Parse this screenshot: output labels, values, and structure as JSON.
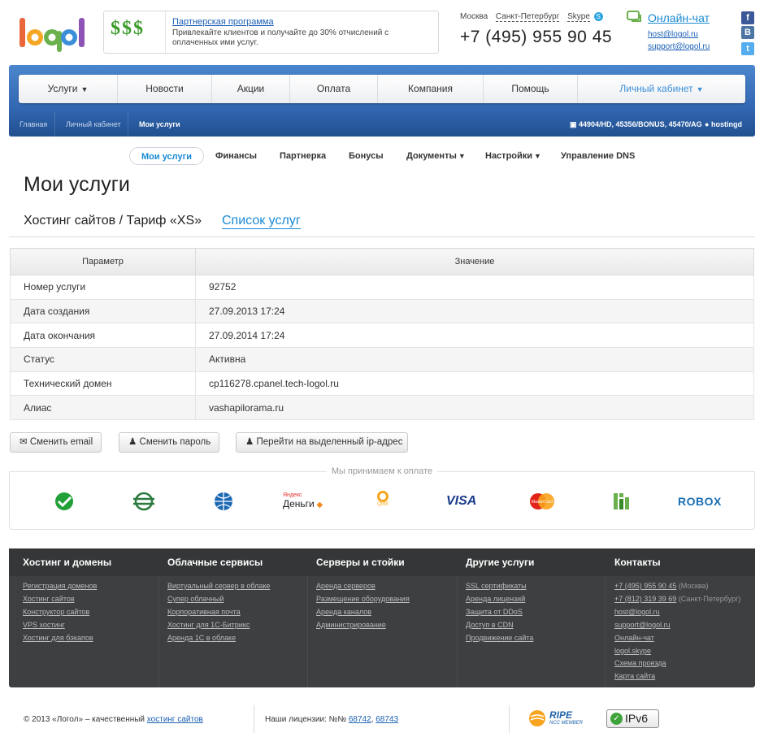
{
  "header": {
    "promo_title": "Партнерская программа",
    "promo_text": "Привлекайте клиентов и получайте до 30% отчислений с оплаченных ими услуг.",
    "cities": [
      "Москва",
      "Санкт-Петербург",
      "Skype"
    ],
    "phone": "+7 (495) 955 90 45",
    "chat": "Онлайн-чат",
    "email1": "host@logol.ru",
    "email2": "support@logol.ru",
    "social": [
      "f",
      "B",
      "t"
    ]
  },
  "menu": [
    "Услуги",
    "Новости",
    "Акции",
    "Оплата",
    "Компания",
    "Помощь",
    "Личный кабинет"
  ],
  "breadcrumbs": [
    "Главная",
    "Личный кабинет",
    "Мои услуги"
  ],
  "account_ids": "44904/HD, 45356/BONUS, 45470/AG",
  "username": "hostingd",
  "subnav": [
    "Мои услуги",
    "Финансы",
    "Партнерка",
    "Бонусы",
    "Документы",
    "Настройки",
    "Управление DNS"
  ],
  "page_title": "Мои услуги",
  "service_title": "Хостинг сайтов / Тариф «XS»",
  "service_list_link": "Список услуг",
  "table": {
    "headers": [
      "Параметр",
      "Значение"
    ],
    "rows": [
      [
        "Номер услуги",
        "92752"
      ],
      [
        "Дата создания",
        "27.09.2013 17:24"
      ],
      [
        "Дата окончания",
        "27.09.2014 17:24"
      ],
      [
        "Статус",
        "Активна"
      ],
      [
        "Технический домен",
        "cp116278.cpanel.tech-logol.ru"
      ],
      [
        "Алиас",
        "vashapilorama.ru"
      ]
    ]
  },
  "buttons": [
    "Сменить email",
    "Сменить пароль",
    "Перейти на выделенный ip-адрес"
  ],
  "payments_title": "Мы принимаем к оплате",
  "payment_labels": {
    "yandex1": "Яндекс",
    "yandex2": "Деньги",
    "qiwi": "QIWI",
    "visa": "VISA",
    "mastercard": "MasterCard",
    "robox": "ROBOX"
  },
  "footer": {
    "columns": [
      {
        "title": "Хостинг и домены",
        "links": [
          "Регистрация доменов",
          "Хостинг сайтов",
          "Конструктор сайтов",
          "VPS хостинг",
          "Хостинг для бэкапов"
        ]
      },
      {
        "title": "Облачные сервисы",
        "links": [
          "Виртуальный сервер в облаке",
          "Супер облачный",
          "Корпоративная почта",
          "Хостинг для 1С-Битрикс",
          "Аренда 1С в облаке"
        ]
      },
      {
        "title": "Серверы и стойки",
        "links": [
          "Аренда серверов",
          "Размещение оборудования",
          "Аренда каналов",
          "Администрирование"
        ]
      },
      {
        "title": "Другие услуги",
        "links": [
          "SSL сертификаты",
          "Аренда лицензий",
          "Защита от DDoS",
          "Доступ в CDN",
          "Продвижение сайта"
        ]
      },
      {
        "title": "Контакты",
        "links": [
          "+7 (495) 955 90 45",
          "+7 (812) 319 39 69",
          "host@logol.ru",
          "support@logol.ru",
          "Онлайн-чат",
          "logol.skype",
          "Схема проезда",
          "Карта сайта"
        ],
        "notes": [
          " (Москва)",
          " (Санкт-Петербург)"
        ]
      }
    ]
  },
  "bottom": {
    "copyright": "© 2013 «Логол» – качественный ",
    "copyright_link": "хостинг сайтов",
    "license_label": "Наши лицензии: №№ ",
    "license1": "68742",
    "license_sep": ", ",
    "license2": "68743",
    "ripe": "RIPE",
    "ripe_sub": "NCC MEMBER",
    "ipv6": "IPv6"
  }
}
